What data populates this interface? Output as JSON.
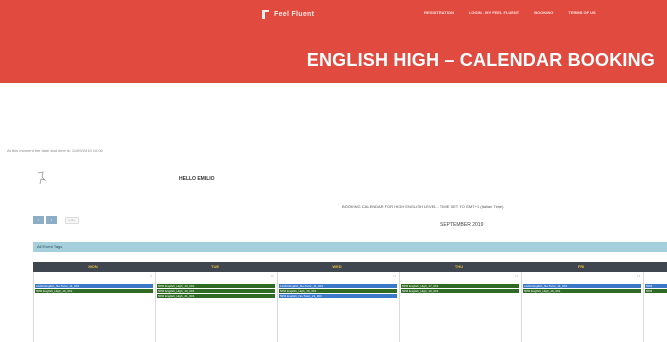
{
  "header": {
    "logo_text": "Feel Fluent",
    "nav": [
      "REGISTRATION",
      "LOGIN - MY FEEL FLUENT",
      "BOOKING",
      "TERMS OF US"
    ],
    "banner_title": "ENGLISH HIGH – CALENDAR BOOKING",
    "bg_color": "#e04a3f"
  },
  "main": {
    "datetime_text": "At this moment the date and time is: 11/09/2019 10:06",
    "hello": "HELLO EMILIO",
    "calendar_title": "BOOKING CALENDAR FOR HIGH ENGLISH LEVEL - TIME SET TO GMT+1 (Italian Time)",
    "month": "SEPTEMBER 2019",
    "prev_label": "‹",
    "next_label": "›",
    "today_label": "today",
    "tags_label": "All Event Tags",
    "days": [
      {
        "name": "MON",
        "num": "9"
      },
      {
        "name": "TUE",
        "num": "10"
      },
      {
        "name": "WED",
        "num": "11"
      },
      {
        "name": "THU",
        "num": "12"
      },
      {
        "name": "FRI",
        "num": "13"
      }
    ],
    "events": {
      "mon": [
        {
          "label": "11AM English_No-Tutor_11_001",
          "color": "blue"
        },
        {
          "label": "5PM English_High_16_001",
          "color": "green"
        }
      ],
      "tue": [
        {
          "label": "5PM English_High_10_001",
          "color": "green"
        },
        {
          "label": "5PM English_High_10_001",
          "color": "green"
        },
        {
          "label": "5PM English_High_21_001",
          "color": "green"
        }
      ],
      "wed": [
        {
          "label": "11AM English_No-Tutor_11_001",
          "color": "blue"
        },
        {
          "label": "5PM English_High_16_001",
          "color": "green"
        },
        {
          "label": "5PM English_No-Tutor_21_001",
          "color": "blue"
        }
      ],
      "thu": [
        {
          "label": "5PM English_High_17_001",
          "color": "green"
        },
        {
          "label": "5PM English_High_10_001",
          "color": "green"
        }
      ],
      "fri": [
        {
          "label": "11AM English_No-Tutor_11_001",
          "color": "blue"
        },
        {
          "label": "5PM English_High_16_001",
          "color": "green"
        }
      ],
      "sat": [
        {
          "label": "5PM",
          "color": "blue"
        },
        {
          "label": "5PM",
          "color": "green"
        }
      ]
    },
    "event_colors": {
      "blue": "#3c78c8",
      "green": "#2f6b25"
    },
    "accent_colors": {
      "tags_bar": "#a6cfdc",
      "day_header": "#3f4650",
      "day_name": "#e6bf3c"
    }
  }
}
